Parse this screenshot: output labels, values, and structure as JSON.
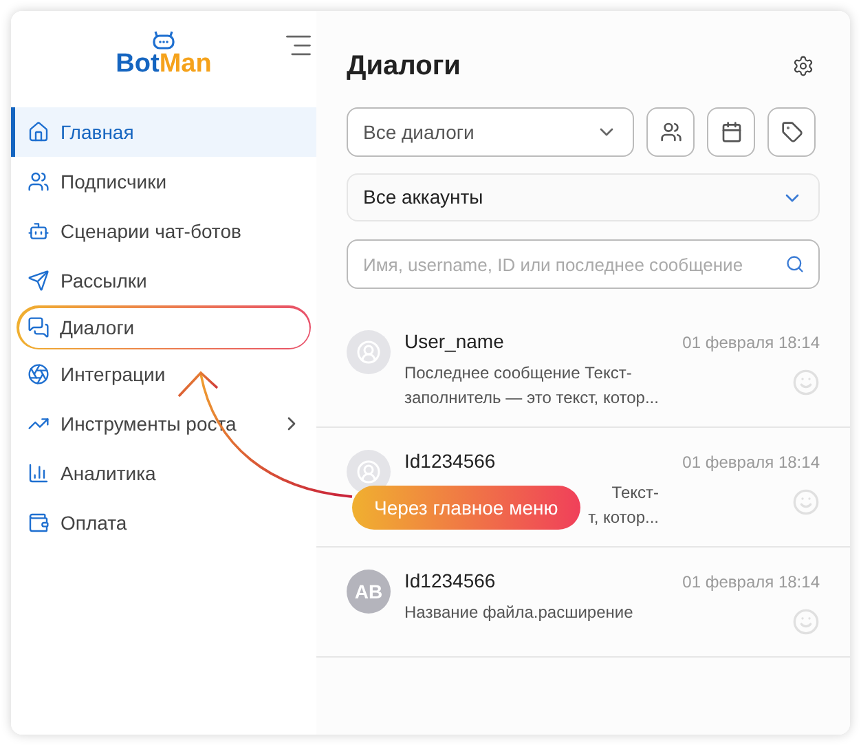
{
  "logo": {
    "part_1": "Bot",
    "part_2": "Man"
  },
  "nav": [
    {
      "label": "Главная",
      "selected": true,
      "highlighted": false,
      "has_submenu": false
    },
    {
      "label": "Подписчики",
      "selected": false,
      "highlighted": false,
      "has_submenu": false
    },
    {
      "label": "Сценарии чат-ботов",
      "selected": false,
      "highlighted": false,
      "has_submenu": false
    },
    {
      "label": "Рассылки",
      "selected": false,
      "highlighted": false,
      "has_submenu": false
    },
    {
      "label": "Диалоги",
      "selected": false,
      "highlighted": true,
      "has_submenu": false
    },
    {
      "label": "Интеграции",
      "selected": false,
      "highlighted": false,
      "has_submenu": false
    },
    {
      "label": "Инструменты роста",
      "selected": false,
      "highlighted": false,
      "has_submenu": true
    },
    {
      "label": "Аналитика",
      "selected": false,
      "highlighted": false,
      "has_submenu": false
    },
    {
      "label": "Оплата",
      "selected": false,
      "highlighted": false,
      "has_submenu": false
    }
  ],
  "page": {
    "title": "Диалоги"
  },
  "filters": {
    "dialogs_select": "Все диалоги",
    "accounts_select": "Все аккаунты",
    "search": {
      "placeholder": "Имя, username, ID или последнее сообщение"
    }
  },
  "dialogs": [
    {
      "name": "User_name",
      "time": "01 февраля 18:14",
      "message_lines": [
        "Последнее сообщение Текст-",
        "заполнитель — это текст, котор..."
      ],
      "partly_covered": false,
      "avatar": {
        "kind": "icon"
      }
    },
    {
      "name": "Id1234566",
      "time": "01 февраля 18:14",
      "message_lines": [
        "Текст-",
        "т, котор..."
      ],
      "partly_covered": true,
      "avatar": {
        "kind": "icon"
      }
    },
    {
      "name": "Id1234566",
      "time": "01 февраля 18:14",
      "message_lines": [
        "Название файла.расширение"
      ],
      "partly_covered": false,
      "avatar": {
        "kind": "initials",
        "initials": "AB"
      }
    }
  ],
  "callout": {
    "label": "Через главное меню"
  }
}
